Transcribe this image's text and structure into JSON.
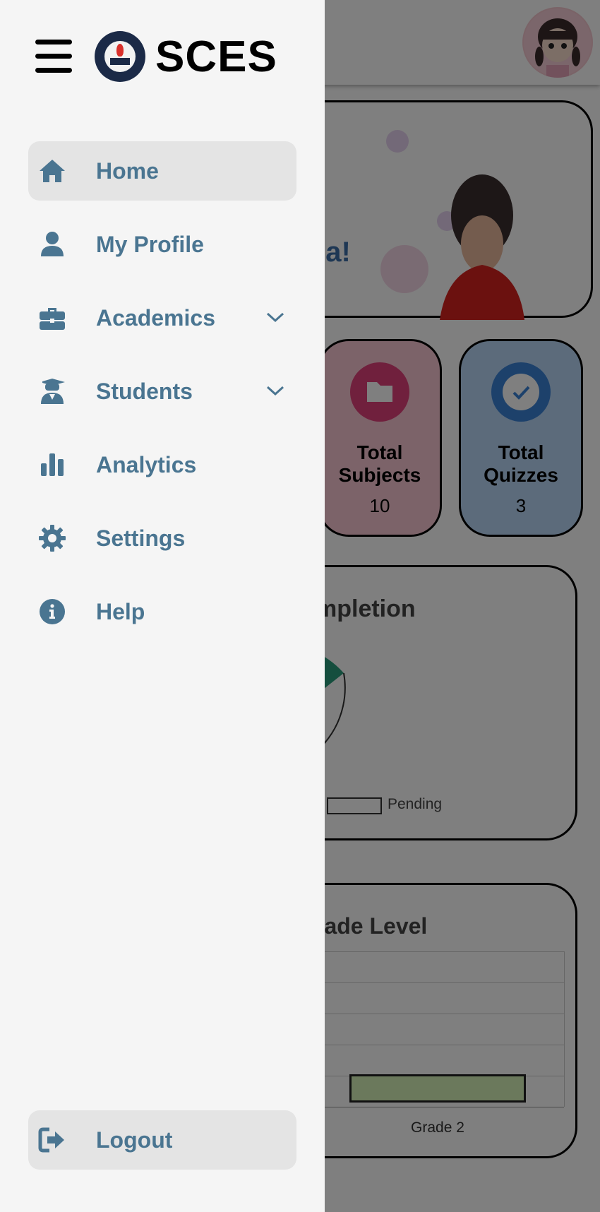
{
  "app": {
    "name": "SCES"
  },
  "sidebar": {
    "items": [
      {
        "label": "Home",
        "icon": "home-icon",
        "active": true
      },
      {
        "label": "My Profile",
        "icon": "user-icon"
      },
      {
        "label": "Academics",
        "icon": "briefcase-icon",
        "expandable": true
      },
      {
        "label": "Students",
        "icon": "graduate-icon",
        "expandable": true
      },
      {
        "label": "Analytics",
        "icon": "bar-chart-icon"
      },
      {
        "label": "Settings",
        "icon": "gear-icon"
      },
      {
        "label": "Help",
        "icon": "info-icon"
      }
    ],
    "logout": {
      "label": "Logout",
      "icon": "logout-icon"
    }
  },
  "dashboard": {
    "greeting_fragment": "sa!",
    "stats": [
      {
        "title": "Total Subjects",
        "value": "10",
        "icon": "folder-icon",
        "color": "#e0407a"
      },
      {
        "title": "Total Quizzes",
        "value": "3",
        "icon": "check-circle-icon",
        "color": "#3b82d6"
      }
    ],
    "completion_title_fragment": "mpletion",
    "legend_pending": "Pending",
    "grade_title_fragment": "rade Level",
    "grade_bar_label": "Grade 2"
  },
  "colors": {
    "accent": "#4a7591",
    "drawer_bg": "#f5f5f5",
    "active_bg": "#e4e4e4",
    "teal": "#2a9d7c"
  }
}
